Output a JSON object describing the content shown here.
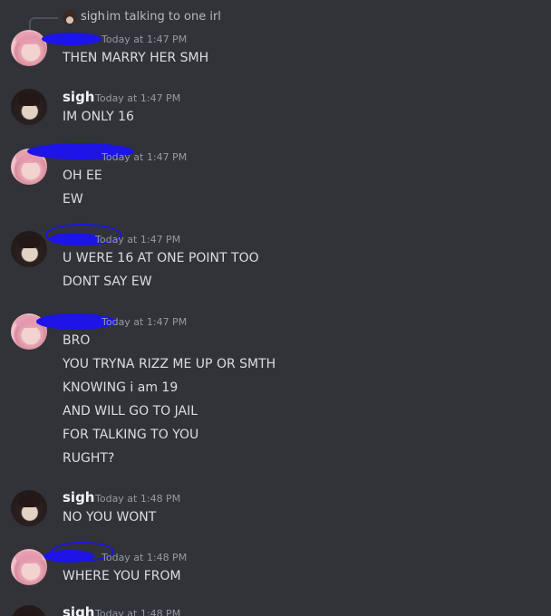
{
  "reply": {
    "username": "sigh",
    "text": "im talking to one irl"
  },
  "messages": [
    {
      "author": "",
      "time": "Today at 1:47 PM",
      "lines": [
        "THEN MARRY HER SMH"
      ]
    },
    {
      "author": "sigh",
      "time": "Today at 1:47 PM",
      "lines": [
        "IM ONLY 16"
      ]
    },
    {
      "author": "",
      "time": "Today at 1:47 PM",
      "lines": [
        "OH EE",
        "EW"
      ]
    },
    {
      "author": "",
      "time": "Today at 1:47 PM",
      "lines": [
        "U WERE 16 AT ONE POINT TOO",
        "DONT SAY EW"
      ]
    },
    {
      "author": "",
      "time": "Today at 1:47 PM",
      "lines": [
        "BRO",
        "YOU TRYNA RIZZ ME UP OR SMTH",
        "KNOWING i am 19",
        "AND WILL GO TO JAIL",
        "FOR TALKING TO YOU",
        "RUGHT?"
      ]
    },
    {
      "author": "sigh",
      "time": "Today at 1:48 PM",
      "lines": [
        "NO YOU WONT"
      ]
    },
    {
      "author": "",
      "time": "Today at 1:48 PM",
      "lines": [
        "WHERE YOU FROM"
      ]
    },
    {
      "author": "sigh",
      "time": "Today at 1:48 PM",
      "lines": []
    }
  ],
  "icons": {
    "avatar_pink": "pink-hair-avatar-icon",
    "avatar_dark": "dark-hair-avatar-icon",
    "reply_avatar": "dark-hair-avatar-icon",
    "redaction": "blue-scribble-redaction"
  },
  "colors": {
    "background": "#313338",
    "text": "#dbdee1",
    "username": "#f2f3f5",
    "timestamp": "#949ba4",
    "redaction": "#1d14e8"
  }
}
